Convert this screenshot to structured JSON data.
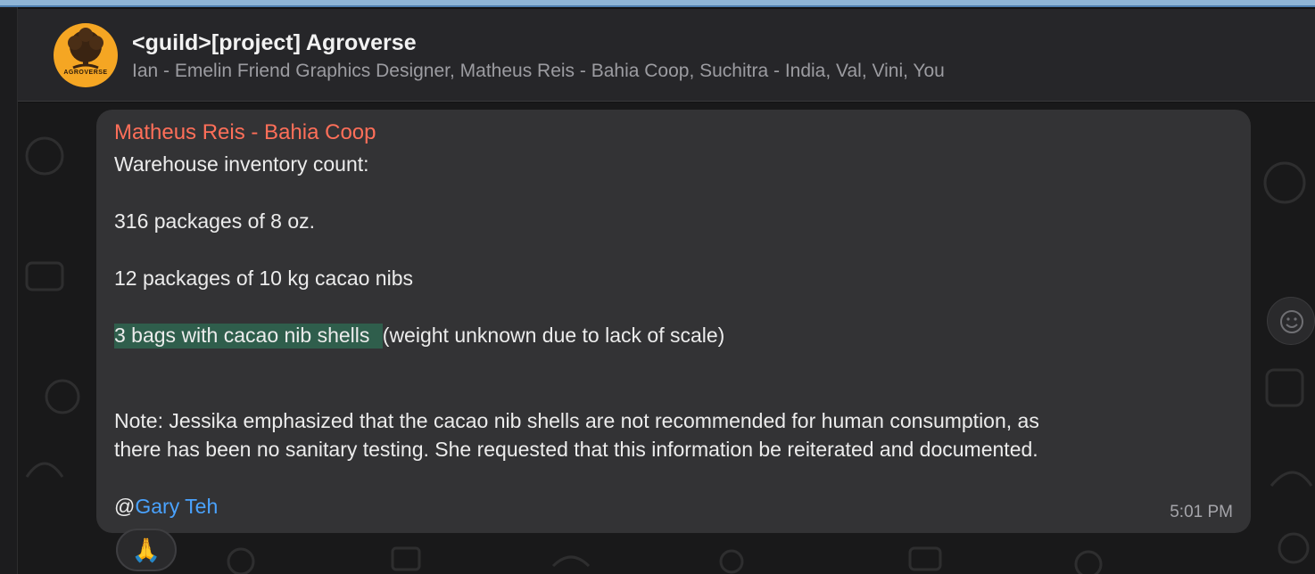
{
  "header": {
    "title": "<guild>[project] Agroverse",
    "members": "Ian - Emelin Friend Graphics Designer, Matheus Reis - Bahia Coop, Suchitra - India, Val, Vini, You",
    "avatar_text": "AGROVERSE",
    "avatar_color": "#f5a623"
  },
  "message": {
    "sender": "Matheus Reis - Bahia Coop",
    "sender_color": "#ff6f59",
    "line1": "Warehouse inventory count:",
    "line2": "316 packages of 8 oz.",
    "line3": "12 packages of 10 kg cacao nibs",
    "line4_highlight": "3 bags with cacao nib shells ",
    "line4_rest": "(weight unknown due to lack of scale)",
    "note1": "Note: Jessika emphasized that the cacao nib shells are not recommended for human consumption, as",
    "note2": "there has been no sanitary testing. She requested that this information be reiterated and documented.",
    "mention_at": "@",
    "mention_name": "Gary Teh",
    "time": "5:01 PM"
  },
  "reaction": {
    "emoji": "🙏"
  }
}
